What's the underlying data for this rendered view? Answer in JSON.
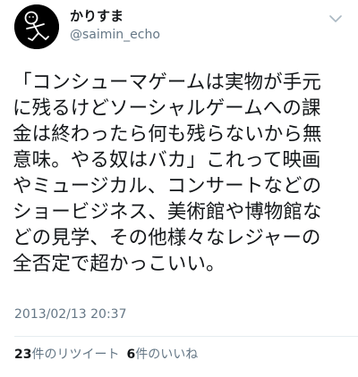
{
  "user": {
    "display_name": "かりすま",
    "handle": "@saimin_echo"
  },
  "menu": {
    "icon": "chevron-down-icon"
  },
  "tweet": {
    "lines": [
      "「コンシューマゲームは実物が手元",
      "に残るけどソーシャルゲームへの課",
      "金は終わったら何も残らないから無",
      "意味。やる奴はバカ」これって映画",
      "やミュージカル、コンサートなどの",
      "ショービジネス、美術館や博物館な",
      "どの見学、その他様々なレジャーの",
      "全否定で超かっこいい。"
    ],
    "timestamp": "2013/02/13 20:37"
  },
  "stats": {
    "retweets_count": "23",
    "retweets_label": "件のリツイート",
    "likes_count": "6",
    "likes_label": "件のいいね"
  }
}
